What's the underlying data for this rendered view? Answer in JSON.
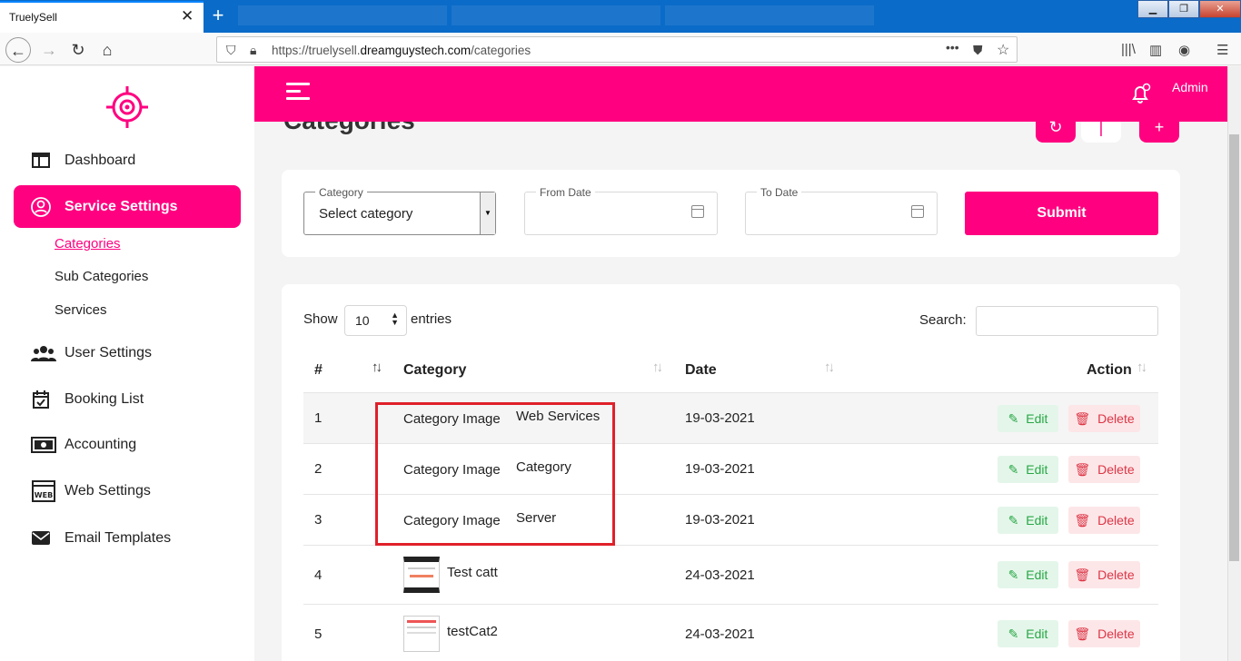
{
  "browser": {
    "tab_title": "TruelySell",
    "tab_close": "✕",
    "new_tab": "+",
    "url_prefix": "https://truelysell.",
    "url_host": "dreamguystech.com",
    "url_path": "/categories"
  },
  "sidebar": {
    "items": [
      {
        "label": "Dashboard",
        "icon": "dashboard-icon"
      },
      {
        "label": "Service Settings",
        "icon": "service-settings-icon"
      },
      {
        "label": "User Settings",
        "icon": "users-icon"
      },
      {
        "label": "Booking List",
        "icon": "calendar-check-icon"
      },
      {
        "label": "Accounting",
        "icon": "money-icon"
      },
      {
        "label": "Web Settings",
        "icon": "web-icon"
      },
      {
        "label": "Email Templates",
        "icon": "envelope-icon"
      }
    ],
    "subitems": [
      "Categories",
      "Sub Categories",
      "Services"
    ]
  },
  "header": {
    "user": "Admin"
  },
  "page": {
    "title": "Categories"
  },
  "filters": {
    "category_label": "Category",
    "category_value": "Select category",
    "from_label": "From Date",
    "to_label": "To Date",
    "submit": "Submit"
  },
  "table": {
    "show_label": "Show",
    "entries_value": "10",
    "entries_label": "entries",
    "search_label": "Search:",
    "columns": [
      "#",
      "Category",
      "Date",
      "Action"
    ],
    "edit_label": "Edit",
    "delete_label": "Delete",
    "rows": [
      {
        "num": "1",
        "image": "Category Image",
        "name": "Web Services",
        "date": "19-03-2021"
      },
      {
        "num": "2",
        "image": "Category Image",
        "name": "Category",
        "date": "19-03-2021"
      },
      {
        "num": "3",
        "image": "Category Image",
        "name": "Server",
        "date": "19-03-2021"
      },
      {
        "num": "4",
        "image": "",
        "name": "Test catt",
        "date": "24-03-2021"
      },
      {
        "num": "5",
        "image": "",
        "name": "testCat2",
        "date": "24-03-2021"
      }
    ]
  },
  "colors": {
    "accent": "#ff0080",
    "highlight_box": "#e0202a"
  }
}
